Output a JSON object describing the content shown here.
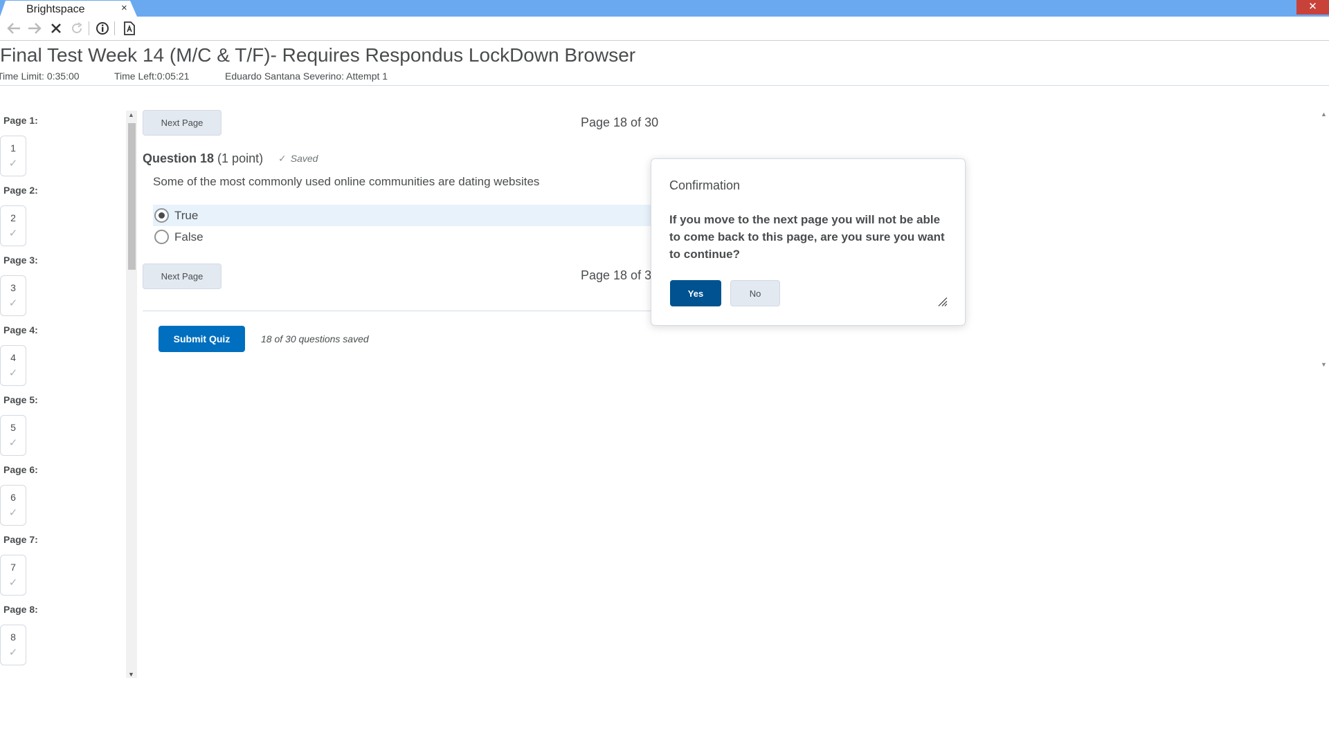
{
  "browser": {
    "tab_title": "Brightspace",
    "tab_close": "×",
    "window_close": "✕",
    "toolbar_icons": [
      "back-arrow-icon",
      "forward-arrow-icon",
      "stop-icon",
      "reload-icon",
      "info-icon",
      "document-lock-icon"
    ]
  },
  "quiz": {
    "title": "Final Test Week 14 (M/C & T/F)- Requires Respondus LockDown Browser",
    "time_limit": "Time Limit: 0:35:00",
    "time_left": "Time Left:0:05:21",
    "attempt": "Eduardo Santana Severino: Attempt 1"
  },
  "nav": {
    "pages": [
      {
        "label": "Page 1:",
        "num": "1"
      },
      {
        "label": "Page 2:",
        "num": "2"
      },
      {
        "label": "Page 3:",
        "num": "3"
      },
      {
        "label": "Page 4:",
        "num": "4"
      },
      {
        "label": "Page 5:",
        "num": "5"
      },
      {
        "label": "Page 6:",
        "num": "6"
      },
      {
        "label": "Page 7:",
        "num": "7"
      },
      {
        "label": "Page 8:",
        "num": "8"
      }
    ],
    "check": "✓"
  },
  "main": {
    "next_page_label": "Next Page",
    "page_indicator": "Page 18 of 30",
    "page_indicator_bottom": "Page 18 of 30",
    "question_title": "Question 18",
    "question_points": "(1 point)",
    "saved_label": "Saved",
    "question_text": "Some of the most commonly used online communities are dating websites",
    "options": [
      {
        "label": "True",
        "selected": true
      },
      {
        "label": "False",
        "selected": false
      }
    ],
    "submit_label": "Submit Quiz",
    "saved_count": "18 of 30 questions saved"
  },
  "dialog": {
    "title": "Confirmation",
    "message": "If you move to the next page you will not be able to come back to this page, are you sure you want to continue?",
    "yes_label": "Yes",
    "no_label": "No"
  },
  "colors": {
    "primary": "#006fbf",
    "dialog_primary": "#005290",
    "titlebar": "#6aa9f0",
    "selected_row": "#e8f2fb"
  }
}
